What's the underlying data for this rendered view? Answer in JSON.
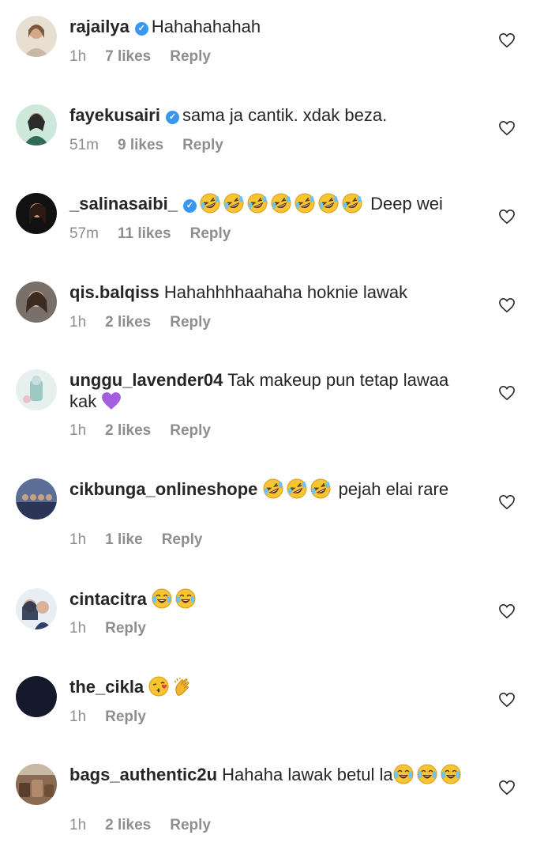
{
  "comments": [
    {
      "username": "rajailya",
      "verified": true,
      "text": "Hahahahahah",
      "time": "1h",
      "likes": "7 likes",
      "reply": "Reply"
    },
    {
      "username": "fayekusairi",
      "verified": true,
      "text": "sama ja cantik. xdak beza.",
      "time": "51m",
      "likes": "9 likes",
      "reply": "Reply"
    },
    {
      "username": "_salinasaibi_",
      "verified": true,
      "text": "Deep wei",
      "time": "57m",
      "likes": "11 likes",
      "reply": "Reply"
    },
    {
      "username": "qis.balqiss",
      "verified": false,
      "text": "Hahahhhhaahaha hoknie lawak",
      "time": "1h",
      "likes": "2 likes",
      "reply": "Reply"
    },
    {
      "username": "unggu_lavender04",
      "verified": false,
      "text": "Tak makeup pun tetap lawaa kak",
      "time": "1h",
      "likes": "2 likes",
      "reply": "Reply"
    },
    {
      "username": "cikbunga_onlineshope",
      "verified": false,
      "text": "pejah elai rare",
      "time": "1h",
      "likes": "1 like",
      "reply": "Reply"
    },
    {
      "username": "cintacitra",
      "verified": false,
      "text": "",
      "time": "1h",
      "likes": "",
      "reply": "Reply"
    },
    {
      "username": "the_cikla",
      "verified": false,
      "text": "",
      "time": "1h",
      "likes": "",
      "reply": "Reply"
    },
    {
      "username": "bags_authentic2u",
      "verified": false,
      "text": "Hahaha lawak betul la",
      "time": "1h",
      "likes": "2 likes",
      "reply": "Reply"
    }
  ],
  "emojis": {
    "rolling-laughing": "rolling-on-floor-laughing-icon",
    "joy": "face-with-tears-of-joy-icon",
    "purple-heart": "purple-heart-icon",
    "kiss": "face-blowing-kiss-icon",
    "clap": "clapping-hands-icon"
  },
  "colors": {
    "verified": "#3897f0",
    "meta": "#8e8e8e",
    "text": "#262626"
  }
}
